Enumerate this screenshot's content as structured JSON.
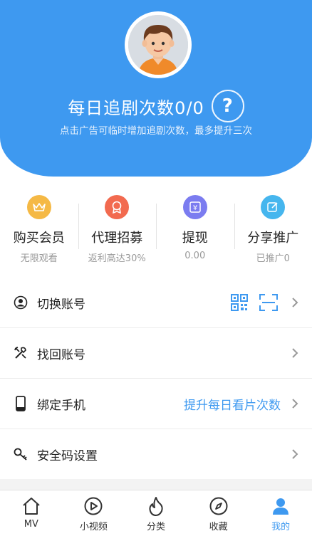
{
  "header": {
    "title": "每日追剧次数0/0",
    "help": "?",
    "subtitle": "点击广告可临时增加追剧次数，最多提升三次"
  },
  "stats": [
    {
      "label": "购买会员",
      "sub": "无限观看",
      "color": "#f5b945",
      "icon": "crown-icon"
    },
    {
      "label": "代理招募",
      "sub": "返利高达30%",
      "color": "#f26a4f",
      "icon": "medal-icon"
    },
    {
      "label": "提现",
      "sub": "0.00",
      "color": "#7b7cf0",
      "icon": "yen-icon"
    },
    {
      "label": "分享推广",
      "sub": "已推广0",
      "color": "#46b6ee",
      "icon": "edit-icon"
    }
  ],
  "menu": {
    "switch_account": "切换账号",
    "recover_account": "找回账号",
    "bind_phone": "绑定手机",
    "bind_phone_hint": "提升每日看片次数",
    "security_code": "安全码设置"
  },
  "tabs": [
    {
      "label": "MV",
      "icon": "home-icon"
    },
    {
      "label": "小视频",
      "icon": "play-icon"
    },
    {
      "label": "分类",
      "icon": "flame-icon"
    },
    {
      "label": "收藏",
      "icon": "compass-icon"
    },
    {
      "label": "我的",
      "icon": "user-icon",
      "active": true
    }
  ],
  "colors": {
    "accent": "#3e99f0"
  }
}
